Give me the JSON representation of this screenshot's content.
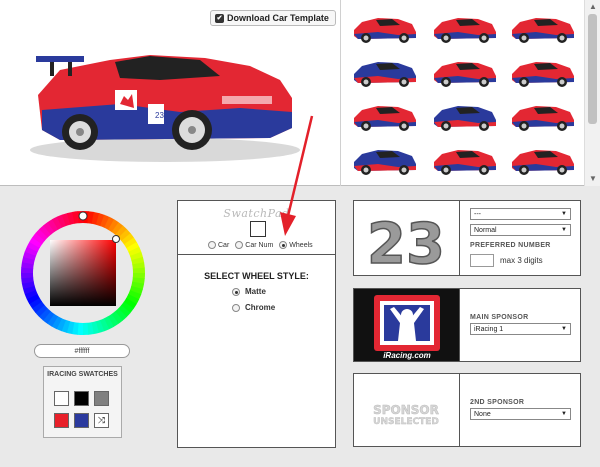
{
  "header": {
    "download_label": "Download Car Template"
  },
  "swatchpad": {
    "title": "SwatchPad",
    "targets": [
      "Car",
      "Car Num",
      "Wheels"
    ],
    "selected_target": "Wheels"
  },
  "wheels": {
    "title": "SELECT WHEEL STYLE:",
    "options": [
      "Matte",
      "Chrome"
    ],
    "selected": "Matte"
  },
  "number": {
    "display": "23",
    "font_select": "---",
    "style_select": "Normal",
    "preferred_label": "PREFERRED NUMBER",
    "max_hint": "max 3 digits",
    "input_value": ""
  },
  "main_sponsor": {
    "label": "MAIN SPONSOR",
    "selected": "iRacing 1",
    "logo_text": "iRacing.com"
  },
  "second_sponsor": {
    "label": "2ND SPONSOR",
    "selected": "None",
    "placeholder_line1": "SPONSOR",
    "placeholder_line2": "UNSELECTED"
  },
  "color_picker": {
    "hex_value": "#ffffff",
    "swatches_title": "IRACING SWATCHES",
    "swatches": [
      "#ffffff",
      "#000000",
      "#808080",
      "#e8202a",
      "#2b3a9e",
      "shuffle"
    ]
  },
  "colors": {
    "car_red": "#e32733",
    "car_blue": "#2a3a9c",
    "arrow_red": "#e3202a"
  }
}
